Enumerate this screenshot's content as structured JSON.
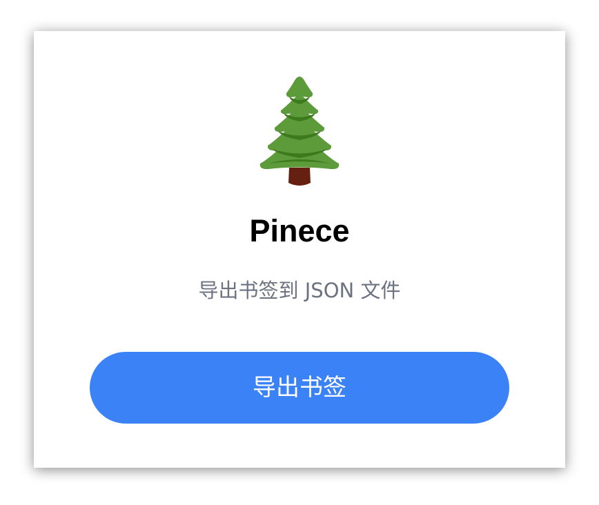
{
  "app": {
    "logo_icon": "evergreen-tree-icon",
    "title": "Pinece",
    "subtitle": "导出书签到 JSON 文件"
  },
  "actions": {
    "export_label": "导出书签"
  },
  "colors": {
    "accent": "#3b82f6",
    "subtitle_text": "#6b7280",
    "title_text": "#000000",
    "tree_green_light": "#5c9a3a",
    "tree_green_dark": "#3d7a1d",
    "trunk_brown": "#66200f"
  }
}
